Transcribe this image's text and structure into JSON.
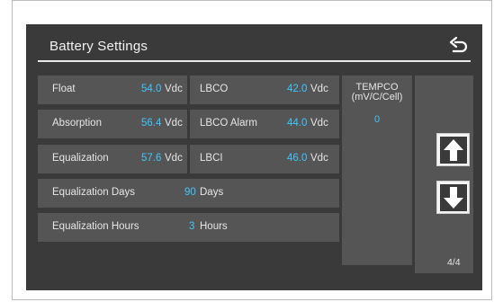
{
  "header": {
    "title": "Battery Settings",
    "back_icon": "return-arrow-icon"
  },
  "settings": {
    "float": {
      "label": "Float",
      "value": "54.0",
      "unit": "Vdc"
    },
    "absorption": {
      "label": "Absorption",
      "value": "56.4",
      "unit": "Vdc"
    },
    "equalization": {
      "label": "Equalization",
      "value": "57.6",
      "unit": "Vdc"
    },
    "lbco": {
      "label": "LBCO",
      "value": "42.0",
      "unit": "Vdc"
    },
    "lbco_alarm": {
      "label": "LBCO Alarm",
      "value": "44.0",
      "unit": "Vdc"
    },
    "lbci": {
      "label": "LBCI",
      "value": "46.0",
      "unit": "Vdc"
    },
    "eq_days": {
      "label": "Equalization Days",
      "value": "90",
      "unit": "Days"
    },
    "eq_hours": {
      "label": "Equalization Hours",
      "value": "3",
      "unit": "Hours"
    }
  },
  "tempco": {
    "label_line1": "TEMPCO",
    "label_line2": "(mV/C/Cell)",
    "value": "0"
  },
  "nav": {
    "up_icon": "arrow-up-icon",
    "down_icon": "arrow-down-icon",
    "page": "4/4"
  },
  "colors": {
    "screen_bg": "#3a3a3a",
    "cell_bg": "#555555",
    "value_accent": "#3fc6ff",
    "text": "#e6e6e6"
  }
}
